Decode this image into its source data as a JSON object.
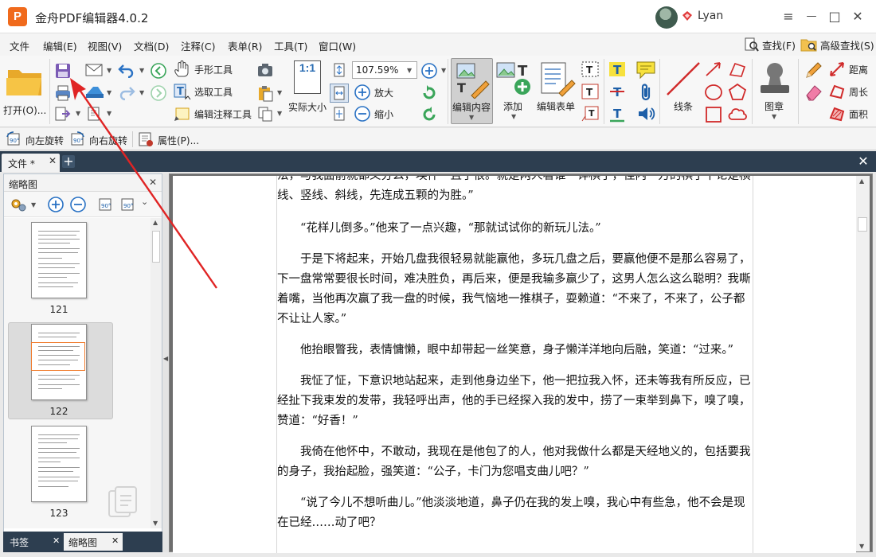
{
  "app": {
    "logo_letter": "P",
    "title": "金舟PDF编辑器4.0.2",
    "user": "Lyan",
    "brand_color": "#f06a1c"
  },
  "window_controls": {
    "menu": "≡",
    "minimize": "—",
    "maximize": "□",
    "close": "✕"
  },
  "menu": {
    "items": [
      "文件",
      "编辑(E)",
      "视图(V)",
      "文档(D)",
      "注释(C)",
      "表单(R)",
      "工具(T)",
      "窗口(W)"
    ],
    "find": "查找(F)",
    "advanced_find": "高级查找(S)"
  },
  "toolbar": {
    "open": "打开(O)...",
    "hand_tool": "手形工具",
    "select_text": "选取工具",
    "edit_annotation": "编辑注释工具",
    "actual_size": "实际大小",
    "actual_size_icon": "1:1",
    "zoom_value": "107.59%",
    "zoom_in": "放大",
    "zoom_out": "缩小",
    "edit_content": "编辑内容",
    "add": "添加",
    "edit_form": "编辑表单",
    "lines": "线条",
    "stamp": "图章",
    "distance": "距离",
    "perimeter": "周长",
    "area": "面积"
  },
  "quickbar": {
    "rotate_left": "向左旋转",
    "rotate_right": "向右旋转",
    "properties": "属性(P)..."
  },
  "tabs": {
    "doc_tab": "文件 *",
    "close": "✕",
    "new": "+",
    "strip_close": "✕"
  },
  "left_panel": {
    "title": "缩略图",
    "close": "✕",
    "pages": [
      {
        "num": "121"
      },
      {
        "num": "122",
        "selected": true
      },
      {
        "num": "123"
      }
    ],
    "bottom_tabs": [
      "书签",
      "缩略图"
    ]
  },
  "document": {
    "paragraphs": [
      "法，与我面前就都义分么，埃件一且了很。就是两人看谁一详棋了，佳内一万的棋了下论是横线、竖线、斜线，先连成五颗的为胜。”",
      "“花样儿倒多。”他来了一点兴趣，“那就试试你的新玩儿法。”",
      "于是下将起来，开始几盘我很轻易就能赢他，多玩几盘之后，要赢他便不是那么容易了，下一盘常常要很长时间，难决胜负，再后来，便是我输多赢少了，这男人怎么这么聪明？我嘶着嘴，当他再次赢了我一盘的时候，我气恼地一推棋子，耍赖道：“不来了，不来了，公子都不让让人家。”",
      "他抬眼瞥我，表情慵懒，眼中却带起一丝笑意，身子懒洋洋地向后融，笑道：“过来。”",
      "我怔了怔，下意识地站起来，走到他身边坐下，他一把拉我入怀，还未等我有所反应，已经扯下我束发的发带，我轻呼出声，他的手已经探入我的发中，捞了一束举到鼻下，嗅了嗅，赞道：“好香！”",
      "我倚在他怀中，不敢动，我现在是他包了的人，他对我做什么都是天经地义的，包括要我的身子，我抬起脸，强笑道：“公子，卡门为您唱支曲儿吧？”",
      "“说了今儿不想听曲儿。”他淡淡地道，鼻子仍在我的发上嗅，我心中有些急，他不会是现在已经……动了吧？"
    ]
  }
}
